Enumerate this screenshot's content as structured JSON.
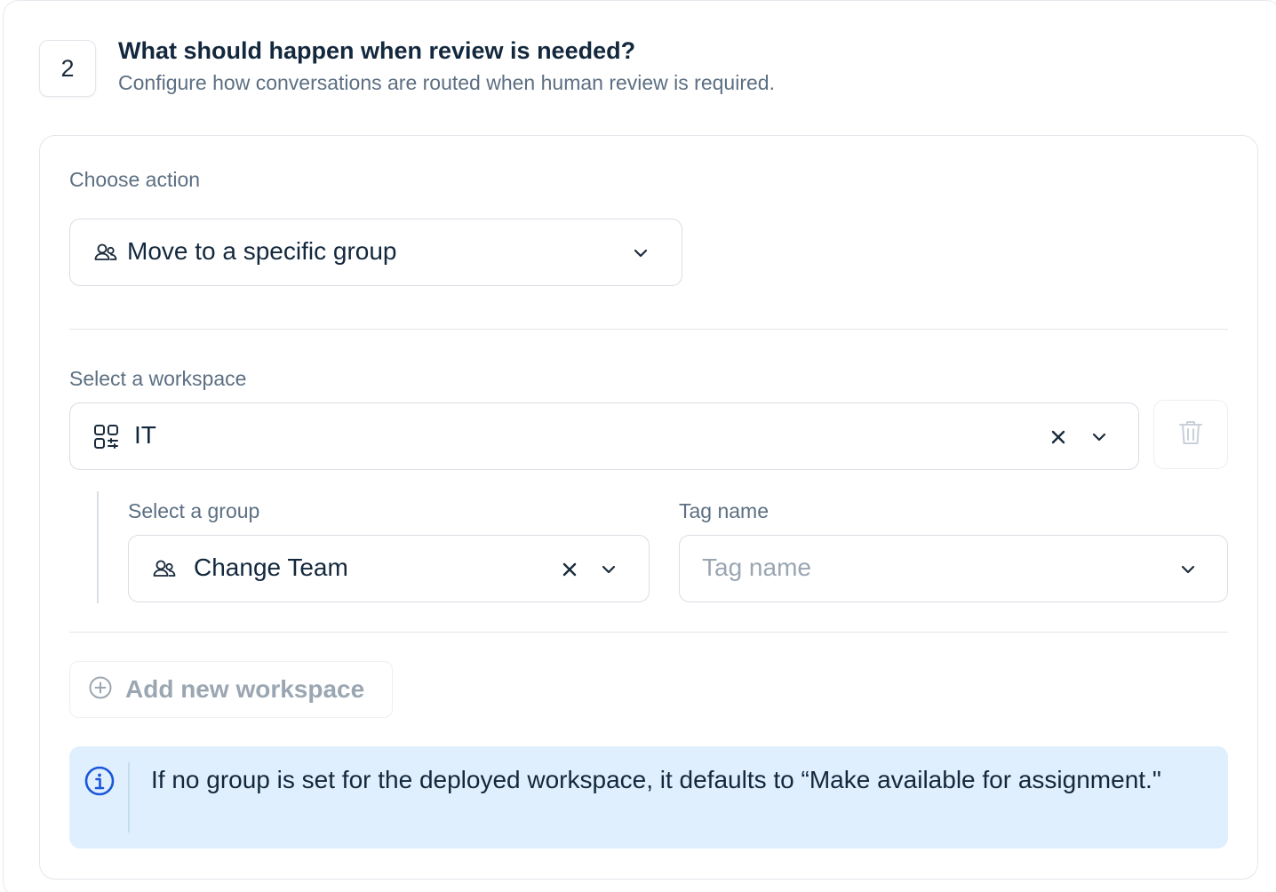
{
  "step": {
    "number": "2",
    "title": "What should happen when review is needed?",
    "subtitle": "Configure how conversations are routed when human review is required."
  },
  "action": {
    "label": "Choose action",
    "value": "Move to a specific group",
    "icon": "group-icon"
  },
  "workspace": {
    "label": "Select a workspace",
    "value": "IT",
    "icon": "workspace-grid-icon"
  },
  "group": {
    "label": "Select a group",
    "value": "Change Team",
    "icon": "group-icon"
  },
  "tag": {
    "label": "Tag name",
    "placeholder": "Tag name"
  },
  "add_workspace": {
    "label": "Add new workspace"
  },
  "info": {
    "message": "If no group is set for the deployed workspace, it defaults to “Make available for assignment.\""
  },
  "colors": {
    "text": "#13283d",
    "muted": "#5c6f82",
    "placeholder": "#9aa6b2",
    "border": "#d9dee5",
    "info_bg": "#dfeffd",
    "info_icon": "#1a56db"
  }
}
